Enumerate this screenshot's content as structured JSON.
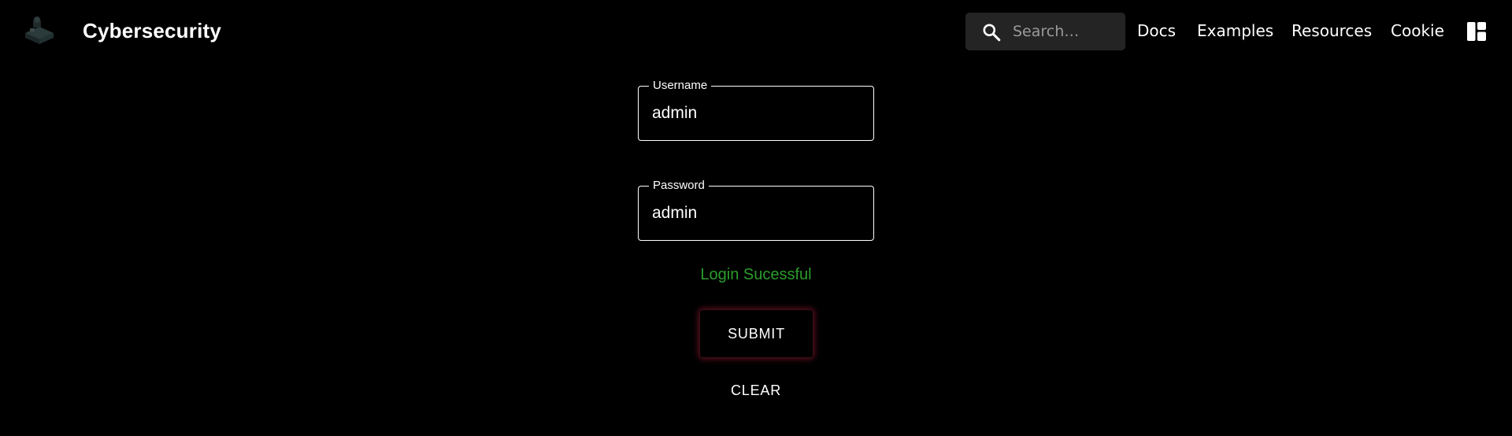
{
  "navbar": {
    "logo_icon": "hacker-laptop-logo-icon",
    "brand": "Cybersecurity",
    "search": {
      "placeholder": "Search…",
      "value": "",
      "icon": "search-icon"
    },
    "links": [
      {
        "label": "Docs"
      },
      {
        "label": "Examples"
      },
      {
        "label": "Resources"
      },
      {
        "label": "Cookie"
      }
    ],
    "layout_icon": "layout-toggle-icon"
  },
  "form": {
    "username": {
      "label": "Username",
      "value": "admin"
    },
    "password": {
      "label": "Password",
      "value": "admin"
    },
    "status": {
      "text": "Login Sucessful",
      "color": "#2a9d2a"
    },
    "submit_label": "SUBMIT",
    "clear_label": "CLEAR"
  },
  "colors": {
    "background": "#000000",
    "text": "#ffffff",
    "search_bg": "#242424",
    "submit_glow": "#b41e3c",
    "success": "#2a9d2a"
  }
}
